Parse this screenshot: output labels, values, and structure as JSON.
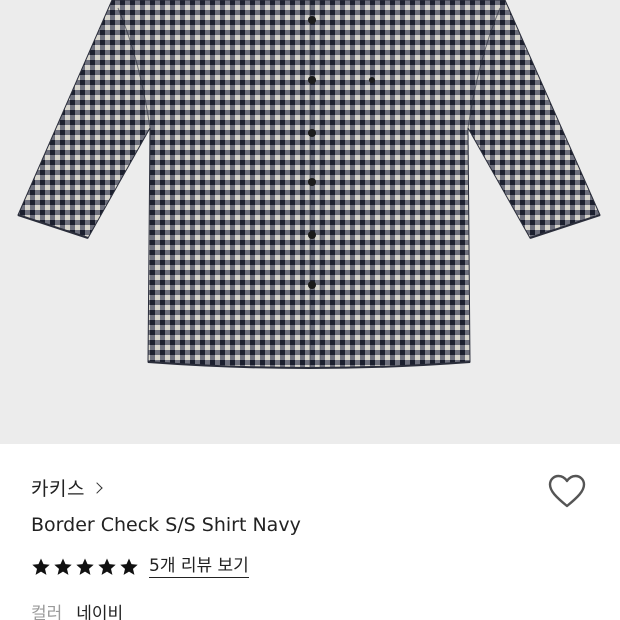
{
  "product": {
    "brand": "카키스",
    "title": "Border Check S/S Shirt Navy",
    "rating_stars": 5,
    "rating_max": 5,
    "review_link_label": "5개 리뷰 보기",
    "color_label": "컬러",
    "color_value": "네이비"
  },
  "image": {
    "subject": "navy-check-short-sleeve-shirt",
    "background_color": "#ececec"
  },
  "icons": {
    "brand_chevron": "chevron-right-icon",
    "wishlist": "heart-outline-icon",
    "star": "star-filled-icon"
  },
  "colors": {
    "text_primary": "#222222",
    "text_muted": "#9a9a9a",
    "star": "#111111"
  }
}
